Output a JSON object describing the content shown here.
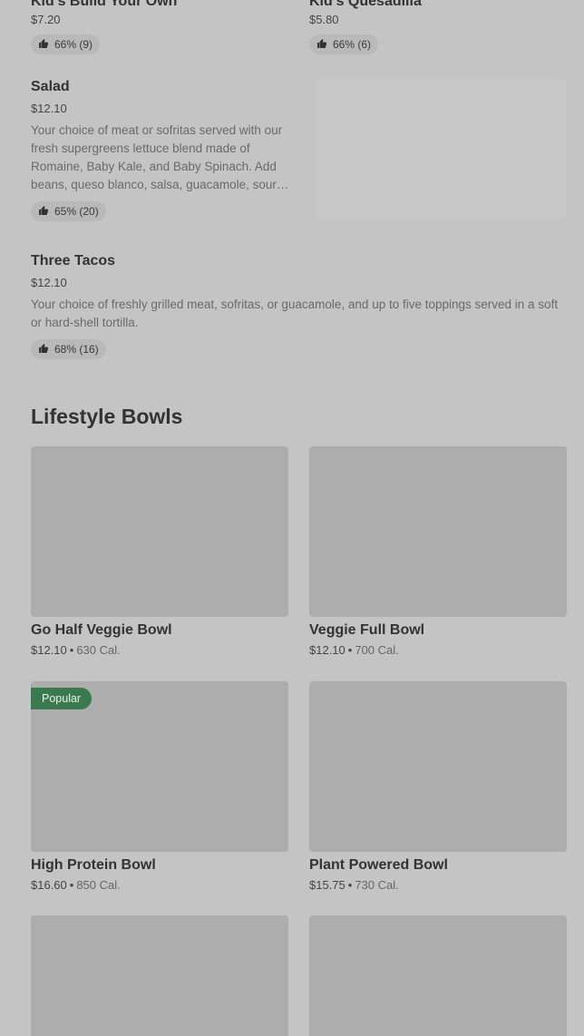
{
  "kids": [
    {
      "name": "Kid's Build Your Own",
      "price": "$7.20",
      "rating": "66% (9)"
    },
    {
      "name": "Kid's Quesadilla",
      "price": "$5.80",
      "rating": "66% (6)"
    }
  ],
  "items": [
    {
      "name": "Salad",
      "price": "$12.10",
      "description": "Your choice of meat or sofritas served with our fresh supergreens lettuce blend made of Romaine, Baby Kale, and Baby Spinach. Add beans, queso blanco, salsa, guacamole, sour…",
      "rating": "65% (20)"
    },
    {
      "name": "Three Tacos",
      "price": "$12.10",
      "description": "Your choice of freshly grilled meat, sofritas, or guacamole, and up to five toppings served in a soft or hard-shell tortilla.",
      "rating": "68% (16)"
    }
  ],
  "section": {
    "title": "Lifestyle Bowls"
  },
  "bowls": [
    {
      "name": "Go Half Veggie Bowl",
      "price": "$12.10",
      "separator": "•",
      "calories": "630 Cal.",
      "badge": ""
    },
    {
      "name": "Veggie Full Bowl",
      "price": "$12.10",
      "separator": "•",
      "calories": "700 Cal.",
      "badge": ""
    },
    {
      "name": "High Protein Bowl",
      "price": "$16.60",
      "separator": "•",
      "calories": "850 Cal.",
      "badge": "Popular"
    },
    {
      "name": "Plant Powered Bowl",
      "price": "$15.75",
      "separator": "•",
      "calories": "730 Cal.",
      "badge": ""
    }
  ],
  "icons": {
    "rating": "thumbs-up-icon"
  },
  "colors": {
    "badge_bg": "#3b7a4e",
    "placeholder": "#adadad",
    "page_bg": "#c4c4c4"
  }
}
